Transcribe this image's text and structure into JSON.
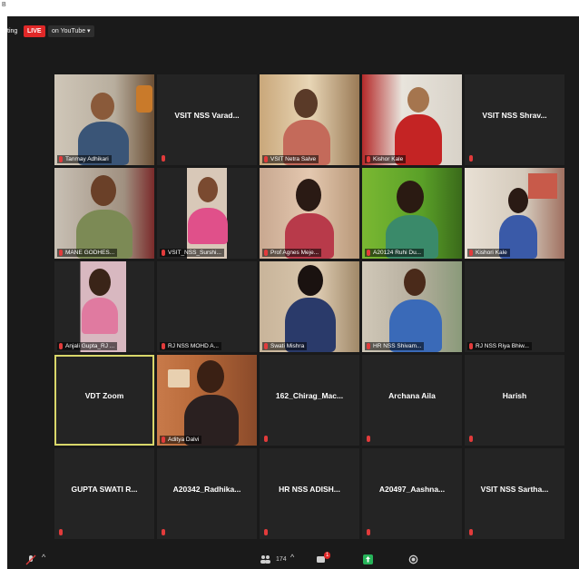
{
  "page": {
    "corner_mark": "B"
  },
  "topbar": {
    "meeting_text": "ting",
    "live": "LIVE",
    "youtube": "on YouTube ▾"
  },
  "tiles": [
    {
      "name": "Tanmay Adhikari"
    },
    {
      "title": "VSIT NSS Varad..."
    },
    {
      "name": "VSIT Netra Salve"
    },
    {
      "name": "Kishor Kale"
    },
    {
      "title": "VSIT NSS Shrav..."
    },
    {
      "name": "MANE GODHES..."
    },
    {
      "name": "VSIT_NSS_Surshi..."
    },
    {
      "name": "Prof Agnes Meje..."
    },
    {
      "name": "A20124 Ruhi Du..."
    },
    {
      "name": "Kishori Kale"
    },
    {
      "name": "Anjali Gupta_RJ ..."
    },
    {
      "name": "RJ NSS MOHD A..."
    },
    {
      "name": "Swati Mishra"
    },
    {
      "name": "HR NSS Shivam..."
    },
    {
      "name": "RJ NSS Riya Bhiw..."
    },
    {
      "title": "VDT Zoom"
    },
    {
      "name": "Aditya Dalvi"
    },
    {
      "title": "162_Chirag_Mac..."
    },
    {
      "title": "Archana Aila"
    },
    {
      "title": "Harish"
    },
    {
      "title": "GUPTA SWATI R..."
    },
    {
      "title": "A20342_Radhika..."
    },
    {
      "title": "HR NSS ADISH..."
    },
    {
      "title": "A20497_Aashna..."
    },
    {
      "title": "VSIT NSS Sartha..."
    }
  ],
  "bottombar": {
    "participants_count": "174",
    "chat_badge": "1"
  },
  "colors": {
    "live": "#e02828",
    "active_outline": "#d9d76a",
    "background": "#1a1a1a",
    "tile": "#242424",
    "mic_muted": "#e23b3b"
  }
}
